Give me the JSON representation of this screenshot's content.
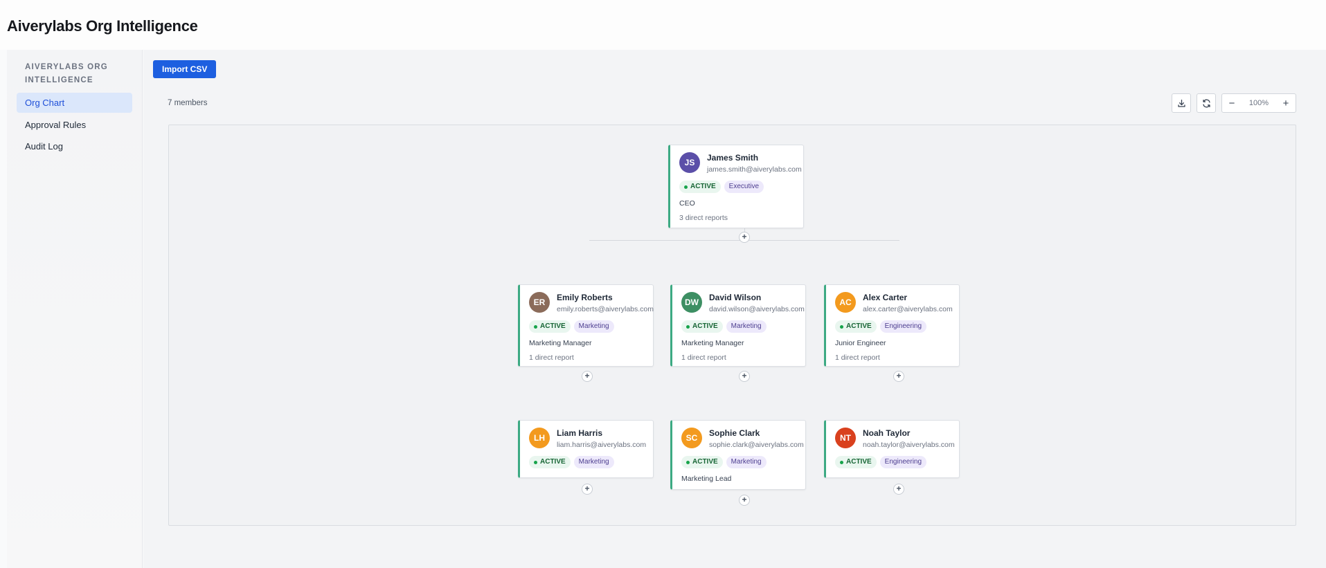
{
  "app": {
    "title": "Aiverylabs Org Intelligence"
  },
  "sidebar": {
    "heading": "AIVERYLABS ORG INTELLIGENCE",
    "items": [
      {
        "label": "Org Chart",
        "active": true
      },
      {
        "label": "Approval Rules",
        "active": false
      },
      {
        "label": "Audit Log",
        "active": false
      }
    ]
  },
  "toolbar": {
    "import_label": "Import CSV",
    "member_count": "7 members",
    "zoom_level": "100%",
    "zoom_out_label": "−",
    "zoom_in_label": "+",
    "icons": [
      "download-icon",
      "refresh-icon"
    ]
  },
  "colors": {
    "primary": "#1d5fe0",
    "active_green": "#3daa83",
    "status_bg": "#e9f6ef",
    "dept_bg": "#ede9fb"
  },
  "add_label": "+",
  "people": [
    {
      "initials": "JS",
      "name": "James Smith",
      "email": "james.smith@aiverylabs.com",
      "status": "ACTIVE",
      "department": "Executive",
      "role": "CEO",
      "reports": "3 direct reports",
      "avatar_color": "#5b4fa8"
    },
    {
      "initials": "ER",
      "name": "Emily Roberts",
      "email": "emily.roberts@aiverylabs.com",
      "status": "ACTIVE",
      "department": "Marketing",
      "role": "Marketing Manager",
      "reports": "1 direct report",
      "avatar_color": "#8b6b5a"
    },
    {
      "initials": "DW",
      "name": "David Wilson",
      "email": "david.wilson@aiverylabs.com",
      "status": "ACTIVE",
      "department": "Marketing",
      "role": "Marketing Manager",
      "reports": "1 direct report",
      "avatar_color": "#3d8f63"
    },
    {
      "initials": "AC",
      "name": "Alex Carter",
      "email": "alex.carter@aiverylabs.com",
      "status": "ACTIVE",
      "department": "Engineering",
      "role": "Junior Engineer",
      "reports": "1 direct report",
      "avatar_color": "#f39a1e"
    },
    {
      "initials": "LH",
      "name": "Liam Harris",
      "email": "liam.harris@aiverylabs.com",
      "status": "ACTIVE",
      "department": "Marketing",
      "role": "",
      "reports": "",
      "avatar_color": "#f39a1e"
    },
    {
      "initials": "SC",
      "name": "Sophie Clark",
      "email": "sophie.clark@aiverylabs.com",
      "status": "ACTIVE",
      "department": "Marketing",
      "role": "Marketing Lead",
      "reports": "",
      "avatar_color": "#f39a1e"
    },
    {
      "initials": "NT",
      "name": "Noah Taylor",
      "email": "noah.taylor@aiverylabs.com",
      "status": "ACTIVE",
      "department": "Engineering",
      "role": "",
      "reports": "",
      "avatar_color": "#d9411e"
    }
  ]
}
